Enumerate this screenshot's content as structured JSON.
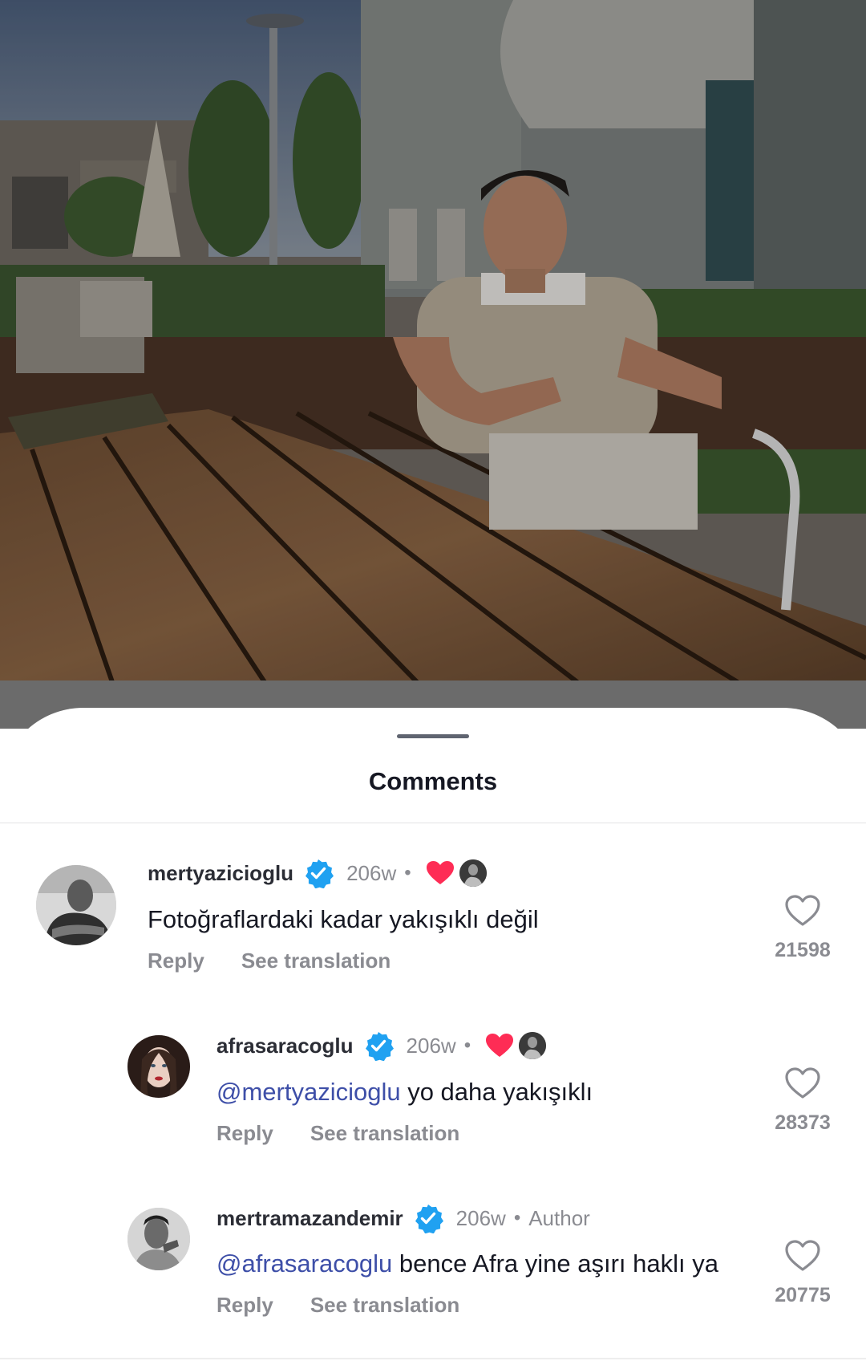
{
  "sheet": {
    "title": "Comments"
  },
  "comments": [
    {
      "username": "mertyazicioglu",
      "time": "206w",
      "text": "Fotoğraflardaki kadar yakışıklı değil",
      "mention": "",
      "reply_label": "Reply",
      "translate_label": "See translation",
      "likes": "21598",
      "liked_by_author": true
    },
    {
      "username": "afrasaracoglu",
      "time": "206w",
      "mention": "@mertyazicioglu",
      "text": " yo daha yakışıklı",
      "reply_label": "Reply",
      "translate_label": "See translation",
      "likes": "28373",
      "liked_by_author": true
    },
    {
      "username": "mertramazandemir",
      "time": "206w",
      "badge": "Author",
      "mention": "@afrasaracoglu",
      "text": " bence Afra yine aşırı haklı ya",
      "reply_label": "Reply",
      "translate_label": "See translation",
      "likes": "20775",
      "liked_by_author": false
    }
  ],
  "icons": {
    "verified": "verified-badge-icon",
    "heart": "heart-outline-icon",
    "liked_by_creator": "heart-filled-icon"
  },
  "colors": {
    "verified": "#20a1f1",
    "liked_heart": "#fe2c55",
    "mention": "#3e4fa8",
    "secondary_text": "#8a8b91"
  }
}
